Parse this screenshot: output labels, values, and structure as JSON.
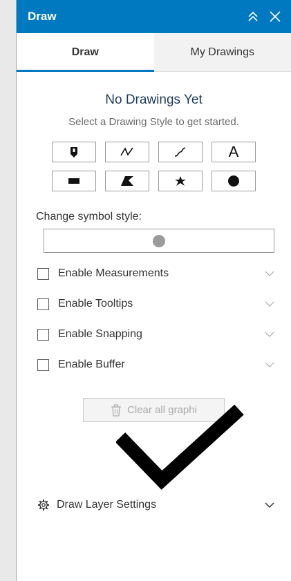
{
  "header": {
    "title": "Draw"
  },
  "tabs": [
    {
      "label": "Draw"
    },
    {
      "label": "My Drawings"
    }
  ],
  "empty_state": {
    "title": "No Drawings Yet",
    "subtitle": "Select a Drawing Style to get started."
  },
  "tools": [
    {
      "name": "point",
      "icon": "point-icon"
    },
    {
      "name": "polyline",
      "icon": "polyline-icon"
    },
    {
      "name": "freehand-line",
      "icon": "freehand-line-icon"
    },
    {
      "name": "text",
      "icon": "text-icon",
      "label": "A"
    },
    {
      "name": "rectangle",
      "icon": "rectangle-icon"
    },
    {
      "name": "polygon",
      "icon": "polygon-icon"
    },
    {
      "name": "freehand-polygon",
      "icon": "freehand-polygon-icon"
    },
    {
      "name": "circle",
      "icon": "circle-icon"
    }
  ],
  "symbol": {
    "label": "Change symbol style:"
  },
  "options": [
    {
      "label": "Enable Measurements"
    },
    {
      "label": "Enable Tooltips"
    },
    {
      "label": "Enable Snapping"
    },
    {
      "label": "Enable Buffer"
    }
  ],
  "clear_button": {
    "label": "Clear all graphi"
  },
  "settings": {
    "label": "Draw Layer Settings"
  },
  "colors": {
    "accent": "#0079c1",
    "title": "#1f3a5c"
  }
}
